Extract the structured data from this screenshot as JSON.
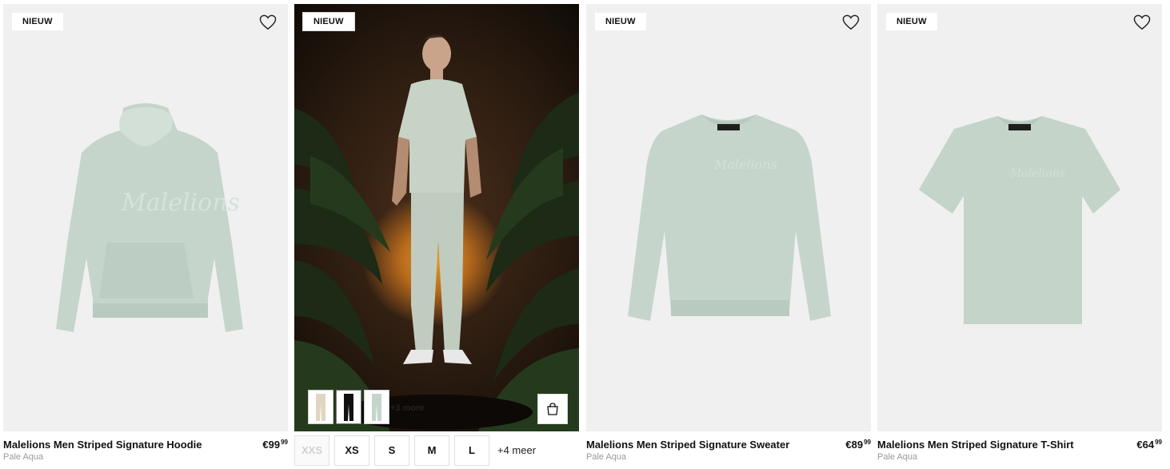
{
  "products": [
    {
      "badge": "NIEUW",
      "name": "Malelions Men Striped Signature Hoodie",
      "color": "Pale Aqua",
      "price_main": "€99",
      "price_cents": "99",
      "icon": "heart-icon"
    },
    {
      "badge": "NIEUW",
      "more_label": "+3 more",
      "sizes": [
        "XXS",
        "XS",
        "S",
        "M",
        "L"
      ],
      "sizes_more": "+4 meer",
      "icon": "shopping-bag-icon"
    },
    {
      "badge": "NIEUW",
      "name": "Malelions Men Striped Signature Sweater",
      "color": "Pale Aqua",
      "price_main": "€89",
      "price_cents": "99",
      "icon": "heart-icon"
    },
    {
      "badge": "NIEUW",
      "name": "Malelions Men Striped Signature T-Shirt",
      "color": "Pale Aqua",
      "price_main": "€64",
      "price_cents": "99",
      "icon": "heart-icon"
    }
  ],
  "colors": {
    "garment": "#c5d5cc",
    "background": "#f0f0f0",
    "muted_text": "#9a9a9a"
  }
}
